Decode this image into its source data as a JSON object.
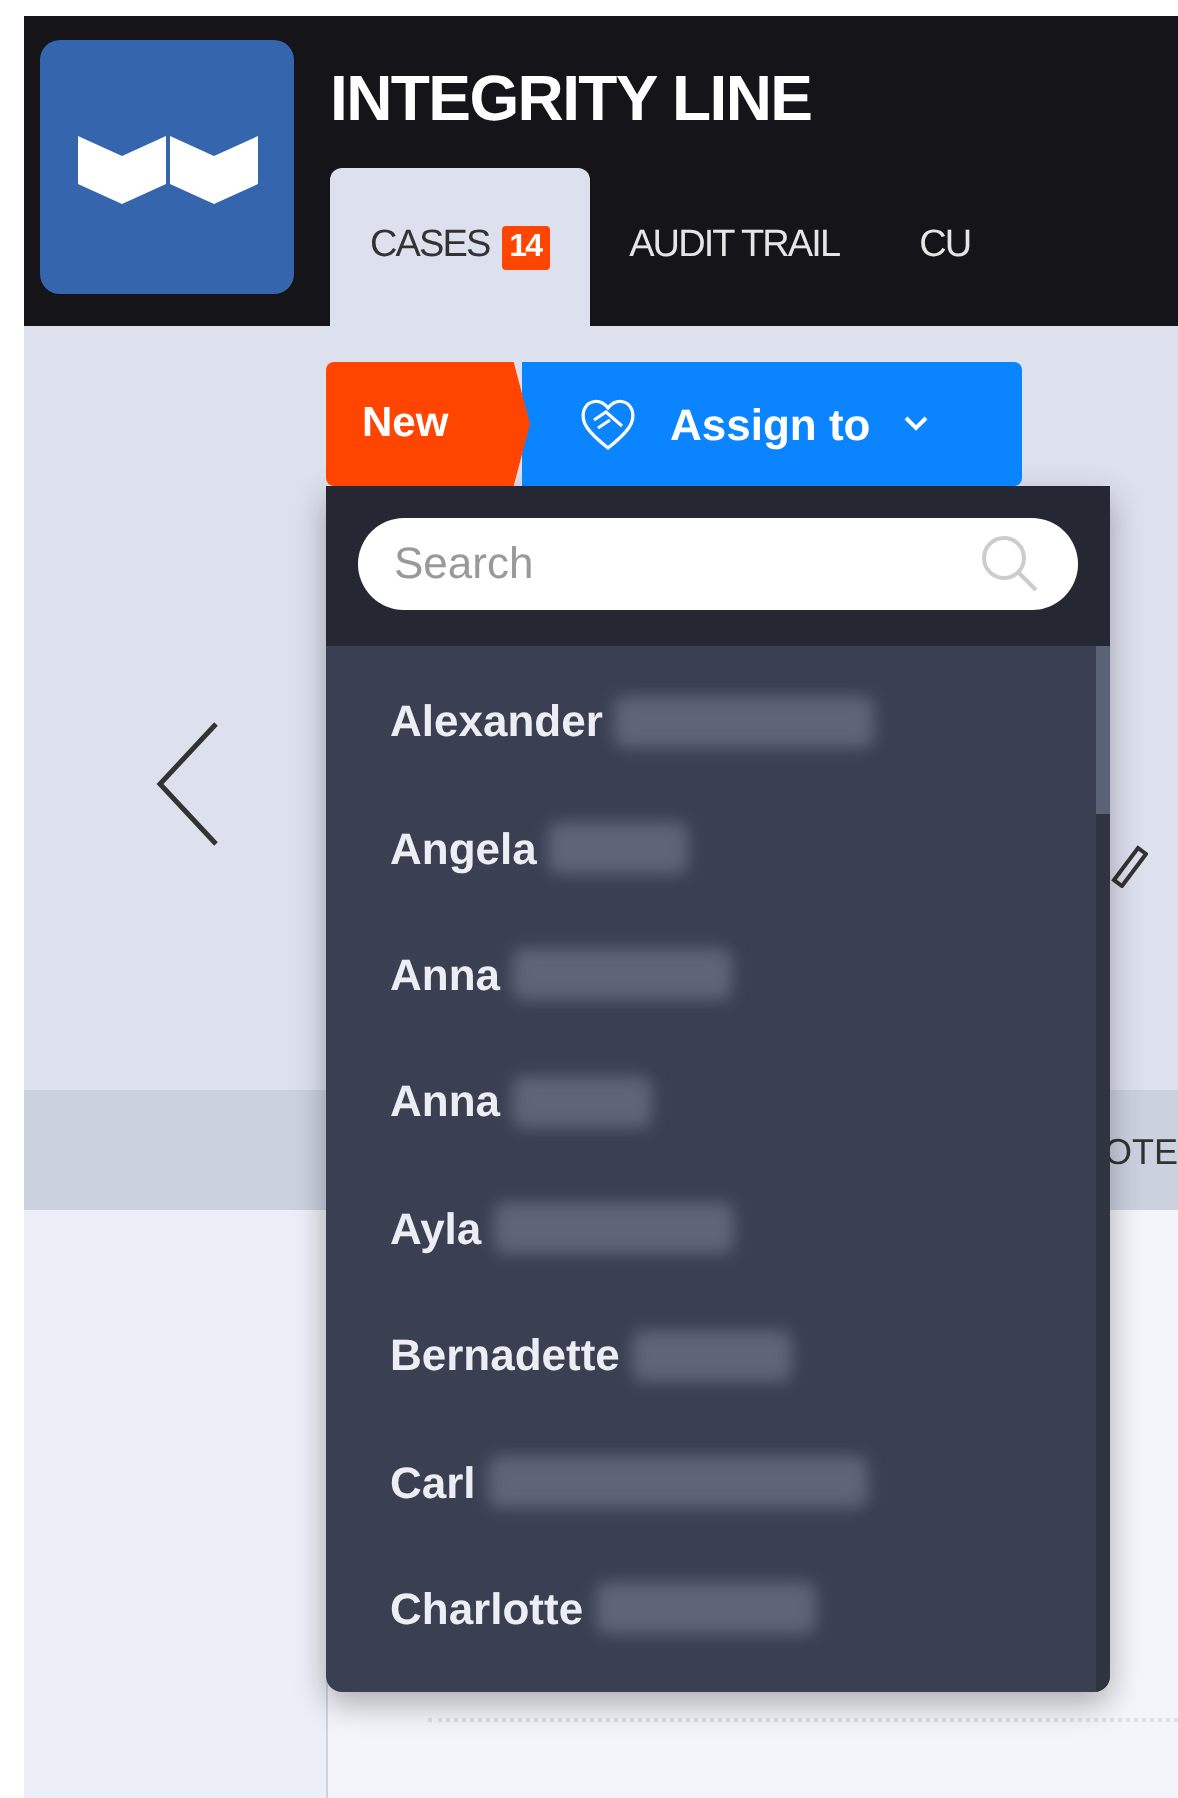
{
  "app": {
    "title": "INTEGRITY LINE"
  },
  "tabs": [
    {
      "label": "CASES",
      "badge": "14",
      "selected": true
    },
    {
      "label": "AUDIT TRAIL",
      "selected": false
    },
    {
      "label": "CU",
      "selected": false
    }
  ],
  "status_button": {
    "label": "New"
  },
  "assign_button": {
    "label": "Assign to"
  },
  "assign_menu": {
    "search": {
      "placeholder": "Search"
    },
    "items": [
      {
        "label": "Alexander"
      },
      {
        "label": "Angela"
      },
      {
        "label": "Anna"
      },
      {
        "label": "Anna"
      },
      {
        "label": "Ayla"
      },
      {
        "label": "Bernadette"
      },
      {
        "label": "Carl"
      },
      {
        "label": "Charlotte"
      }
    ]
  },
  "background_tab": {
    "label": "OTE"
  }
}
